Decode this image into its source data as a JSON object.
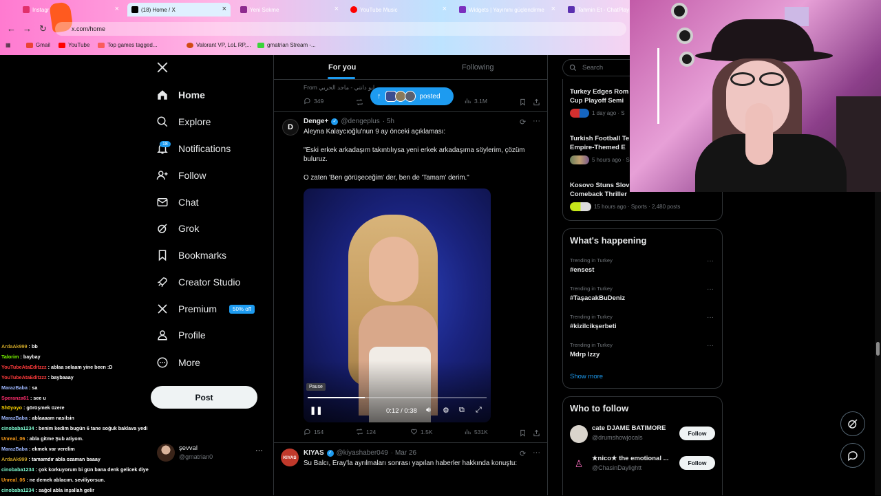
{
  "browser": {
    "tabs": [
      {
        "label": "Instagr",
        "color": "#e1306c"
      },
      {
        "label": "(18) Home / X",
        "color": "#000000"
      },
      {
        "label": "Yeni Sekme",
        "color": "#8e2a8e"
      },
      {
        "label": "YouTube Music",
        "color": "#ff0000"
      },
      {
        "label": "Widgets | Yayınını güçlendirme",
        "color": "#7b2fbe"
      },
      {
        "label": "Tahmin Et - ChatPlay",
        "color": "#5a2fb0"
      }
    ],
    "url": "x.com/home",
    "bookmarks": [
      "Gmail",
      "YouTube",
      "Top games tagged...",
      "Valorant VP, LoL RP,...",
      "gmatrian Stream -..."
    ]
  },
  "sidebar": {
    "items": [
      {
        "label": "Home",
        "icon": "home-icon"
      },
      {
        "label": "Explore",
        "icon": "search-icon"
      },
      {
        "label": "Notifications",
        "icon": "bell-icon"
      },
      {
        "label": "Follow",
        "icon": "add-user-icon"
      },
      {
        "label": "Chat",
        "icon": "mail-icon"
      },
      {
        "label": "Grok",
        "icon": "grok-icon"
      },
      {
        "label": "Bookmarks",
        "icon": "bookmark-icon"
      },
      {
        "label": "Creator Studio",
        "icon": "rocket-icon"
      },
      {
        "label": "Premium",
        "icon": "x-logo-icon"
      },
      {
        "label": "Profile",
        "icon": "user-icon"
      },
      {
        "label": "More",
        "icon": "more-icon"
      }
    ],
    "notif_badge": "18",
    "premium_pill": "50% off",
    "post_label": "Post",
    "account": {
      "name": "şevval",
      "handle": "@gmatrian0"
    }
  },
  "chat": [
    {
      "user": "ArdaAk999",
      "msg": "bb",
      "color": "#c9a227"
    },
    {
      "user": "Talorim",
      "msg": "baybay",
      "color": "#7cfc00"
    },
    {
      "user": "YouTubeAtaEditzzz",
      "msg": "ablaa selaam yine been :D",
      "color": "#ff3b3b"
    },
    {
      "user": "YouTubeAtaEditzzz",
      "msg": "baybaaay",
      "color": "#ff3b3b"
    },
    {
      "user": "MarazBaba",
      "msg": "sa",
      "color": "#9fb8ff"
    },
    {
      "user": "Speranza61",
      "msg": "see u",
      "color": "#ff2e6e"
    },
    {
      "user": "Sh0yoyo",
      "msg": "görüşmek üzere",
      "color": "#ffd700"
    },
    {
      "user": "MarazBaba",
      "msg": "ablaaaam nasilsin",
      "color": "#9fb8ff"
    },
    {
      "user": "cinobaba1234",
      "msg": "benim kedim bugün 6 tane soğuk baklava yedi",
      "color": "#7fffd4"
    },
    {
      "user": "Unreal_06",
      "msg": "abla gitme Şub atiyom.",
      "color": "#ff9f1a"
    },
    {
      "user": "MarazBaba",
      "msg": "ekmek var verelim",
      "color": "#9fb8ff"
    },
    {
      "user": "ArdaAk999",
      "msg": "tamamdır abla ozaman baaay",
      "color": "#c9a227"
    },
    {
      "user": "cinobaba1234",
      "msg": "çok korkuyorum bi gün bana denk gelicek diye",
      "color": "#7fffd4"
    },
    {
      "user": "Unreal_06",
      "msg": "ne demek ablacım. seviliyorsun.",
      "color": "#ff9f1a"
    },
    {
      "user": "cinobaba1234",
      "msg": "sağol abla inşallah gelir",
      "color": "#7fffd4"
    }
  ],
  "feed": {
    "tabs": [
      "For you",
      "Following"
    ],
    "top_from": "From ابو دانتي - ماجد الحربي",
    "top_stats": {
      "replies": "349",
      "views": "3.1M"
    },
    "posted_pill": "posted",
    "tweet": {
      "name": "Denge+",
      "handle": "@dengeplus",
      "time": "· 5h",
      "text1": "Aleyna Kalaycıoğlu'nun 9 ay önceki açıklaması:",
      "text2": "\"Eski erkek arkadaşım takıntılıysa yeni erkek arkadaşıma söylerim, çözüm buluruz.",
      "text3": "O zaten 'Ben görüşeceğim' der, ben de 'Tamam' derim.\"",
      "video": {
        "tooltip": "Pause",
        "time": "0:12 / 0:38",
        "progress": 0.32
      },
      "stats": {
        "replies": "154",
        "reposts": "124",
        "likes": "1.5K",
        "views": "531K"
      }
    },
    "next": {
      "name": "KIYAS",
      "handle": "@kiyashaber049",
      "time": "· Mar 26",
      "avatar_label": "KIYAS",
      "text": "Su Balcı, Eray'la ayrılmaları sonrası yapılan haberler hakkında konuştu:"
    }
  },
  "right": {
    "search_placeholder": "Search",
    "news": [
      {
        "title1": "Turkey Edges Rom",
        "title2": "Cup Playoff Semi",
        "meta": "1 day ago · S"
      },
      {
        "title1": "Turkish Football Te",
        "title2": "Empire-Themed E",
        "meta": "5 hours ago · S"
      },
      {
        "title1": "Kosovo Stuns Slov",
        "title2": "Comeback Thriller",
        "meta": "15 hours ago · Sports · 2,480 posts"
      }
    ],
    "happening_title": "What's happening",
    "trends": [
      {
        "meta": "Trending in Turkey",
        "name": "#ensest"
      },
      {
        "meta": "Trending in Turkey",
        "name": "#TaşacakBuDeniz"
      },
      {
        "meta": "Trending in Turkey",
        "name": "#kizilcikşerbeti"
      },
      {
        "meta": "Trending in Turkey",
        "name": "Mdrp Izzy"
      }
    ],
    "show_more": "Show more",
    "who_title": "Who to follow",
    "follows": [
      {
        "name": "cate DJAME BATIMORE",
        "handle": "@drumshowjocals"
      },
      {
        "name": "★nico★ the emotional ...",
        "handle": "@ChasinDaylightt"
      }
    ],
    "follow_label": "Follow"
  }
}
